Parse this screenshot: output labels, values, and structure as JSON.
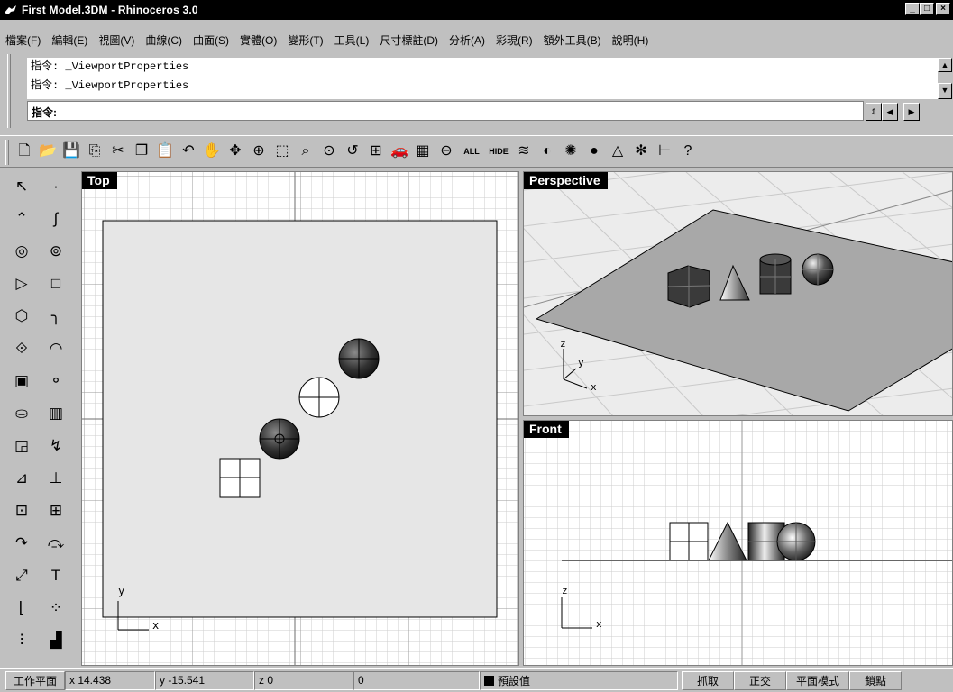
{
  "window": {
    "title": "First Model.3DM - Rhinoceros 3.0",
    "buttons": {
      "minimize": "_",
      "maximize": "□",
      "close": "×"
    }
  },
  "menu": [
    {
      "label": "檔案(F)"
    },
    {
      "label": "編輯(E)"
    },
    {
      "label": "視圖(V)"
    },
    {
      "label": "曲線(C)"
    },
    {
      "label": "曲面(S)"
    },
    {
      "label": "實體(O)"
    },
    {
      "label": "變形(T)"
    },
    {
      "label": "工具(L)"
    },
    {
      "label": "尺寸標註(D)"
    },
    {
      "label": "分析(A)"
    },
    {
      "label": "彩現(R)"
    },
    {
      "label": "額外工具(B)"
    },
    {
      "label": "說明(H)"
    }
  ],
  "command": {
    "history": [
      "指令: _ViewportProperties",
      "指令: _ViewportProperties"
    ],
    "prompt": "指令:"
  },
  "toolbar": {
    "tools": [
      {
        "name": "new-file-icon",
        "glyph": "🗋"
      },
      {
        "name": "open-file-icon",
        "glyph": "📂"
      },
      {
        "name": "save-icon",
        "glyph": "💾"
      },
      {
        "name": "export-icon",
        "glyph": "⎘"
      },
      {
        "name": "cut-icon",
        "glyph": "✂"
      },
      {
        "name": "copy-icon",
        "glyph": "❐"
      },
      {
        "name": "paste-icon",
        "glyph": "📋"
      },
      {
        "name": "undo-icon",
        "glyph": "↶"
      },
      {
        "name": "pan-hand-icon",
        "glyph": "✋"
      },
      {
        "name": "rotate-view-icon",
        "glyph": "✥"
      },
      {
        "name": "zoom-icon",
        "glyph": "⊕"
      },
      {
        "name": "zoom-window-icon",
        "glyph": "⬚"
      },
      {
        "name": "zoom-extents-icon",
        "glyph": "⌕"
      },
      {
        "name": "zoom-selected-icon",
        "glyph": "⊙"
      },
      {
        "name": "zoom-previous-icon",
        "glyph": "↺"
      },
      {
        "name": "four-viewports-icon",
        "glyph": "⊞"
      },
      {
        "name": "car-icon",
        "glyph": "🚗"
      },
      {
        "name": "layer-icon",
        "glyph": "▦"
      },
      {
        "name": "show-icon",
        "glyph": "⊖"
      }
    ],
    "text_tools": [
      {
        "name": "show-all-button",
        "label": "ALL"
      },
      {
        "name": "hide-button",
        "label": "HIDE"
      }
    ],
    "tools_right": [
      {
        "name": "layers-stack-icon",
        "glyph": "≋"
      },
      {
        "name": "shade-icon",
        "glyph": "◐"
      },
      {
        "name": "render-preview-icon",
        "glyph": "✺"
      },
      {
        "name": "render-sphere-icon",
        "glyph": "●"
      },
      {
        "name": "light-icon",
        "glyph": "△"
      },
      {
        "name": "settings-gear-icon",
        "glyph": "✻"
      },
      {
        "name": "dimension-icon",
        "glyph": "⊢"
      },
      {
        "name": "help-icon",
        "glyph": "?"
      }
    ]
  },
  "palette": [
    {
      "name": "select-arrow-icon",
      "glyph": "↖"
    },
    {
      "name": "point-icon",
      "glyph": "·"
    },
    {
      "name": "polyline-icon",
      "glyph": "⌃"
    },
    {
      "name": "curve-icon",
      "glyph": "∫"
    },
    {
      "name": "circle-icon",
      "glyph": "◎"
    },
    {
      "name": "ellipse-icon",
      "glyph": "⊚"
    },
    {
      "name": "arc-icon",
      "glyph": "▷"
    },
    {
      "name": "rectangle-icon",
      "glyph": "□"
    },
    {
      "name": "polygon-icon",
      "glyph": "⬡"
    },
    {
      "name": "fillet-curve-icon",
      "glyph": "╮"
    },
    {
      "name": "surface-points-icon",
      "glyph": "⟐"
    },
    {
      "name": "loft-icon",
      "glyph": "◠"
    },
    {
      "name": "box-icon",
      "glyph": "▣"
    },
    {
      "name": "solid-union-icon",
      "glyph": "⚬"
    },
    {
      "name": "cylinder-icon",
      "glyph": "⛀"
    },
    {
      "name": "mesh-icon",
      "glyph": "▥"
    },
    {
      "name": "transform-icon",
      "glyph": "◲"
    },
    {
      "name": "trim-icon",
      "glyph": "↯"
    },
    {
      "name": "split-icon",
      "glyph": "⊿"
    },
    {
      "name": "join-icon",
      "glyph": "⊥"
    },
    {
      "name": "group-icon",
      "glyph": "⊡"
    },
    {
      "name": "array-icon",
      "glyph": "⊞"
    },
    {
      "name": "rotate-icon",
      "glyph": "↷"
    },
    {
      "name": "scale-icon",
      "glyph": "⤼"
    },
    {
      "name": "dim-icon",
      "glyph": "⤢"
    },
    {
      "name": "text-icon",
      "glyph": "T"
    },
    {
      "name": "corner-icon",
      "glyph": "⌊"
    },
    {
      "name": "points-grid-icon",
      "glyph": "⁘"
    },
    {
      "name": "cplane-icon",
      "glyph": "⫶"
    },
    {
      "name": "layout-icon",
      "glyph": "▟"
    }
  ],
  "viewports": {
    "top": {
      "title": "Top",
      "axis_y": "y",
      "axis_x": "x"
    },
    "perspective": {
      "title": "Perspective",
      "axis_z": "z",
      "axis_y": "y",
      "axis_x": "x"
    },
    "front": {
      "title": "Front",
      "axis_z": "z",
      "axis_x": "x"
    }
  },
  "status": {
    "cplane_label": "工作平面",
    "x": "x 14.438",
    "y": "y -15.541",
    "z": "z 0",
    "extra": "0",
    "layer": "預設值",
    "snap": "抓取",
    "ortho": "正交",
    "planar": "平面模式",
    "osnap": "鎖點"
  },
  "colors": {
    "chrome": "#c0c0c0",
    "viewport_bg": "#ffffff",
    "grid_line": "#c8c8c8",
    "plane_fill": "#e6e6e6",
    "persp_bg": "#ececec",
    "persp_plane": "#a8a8a8"
  }
}
